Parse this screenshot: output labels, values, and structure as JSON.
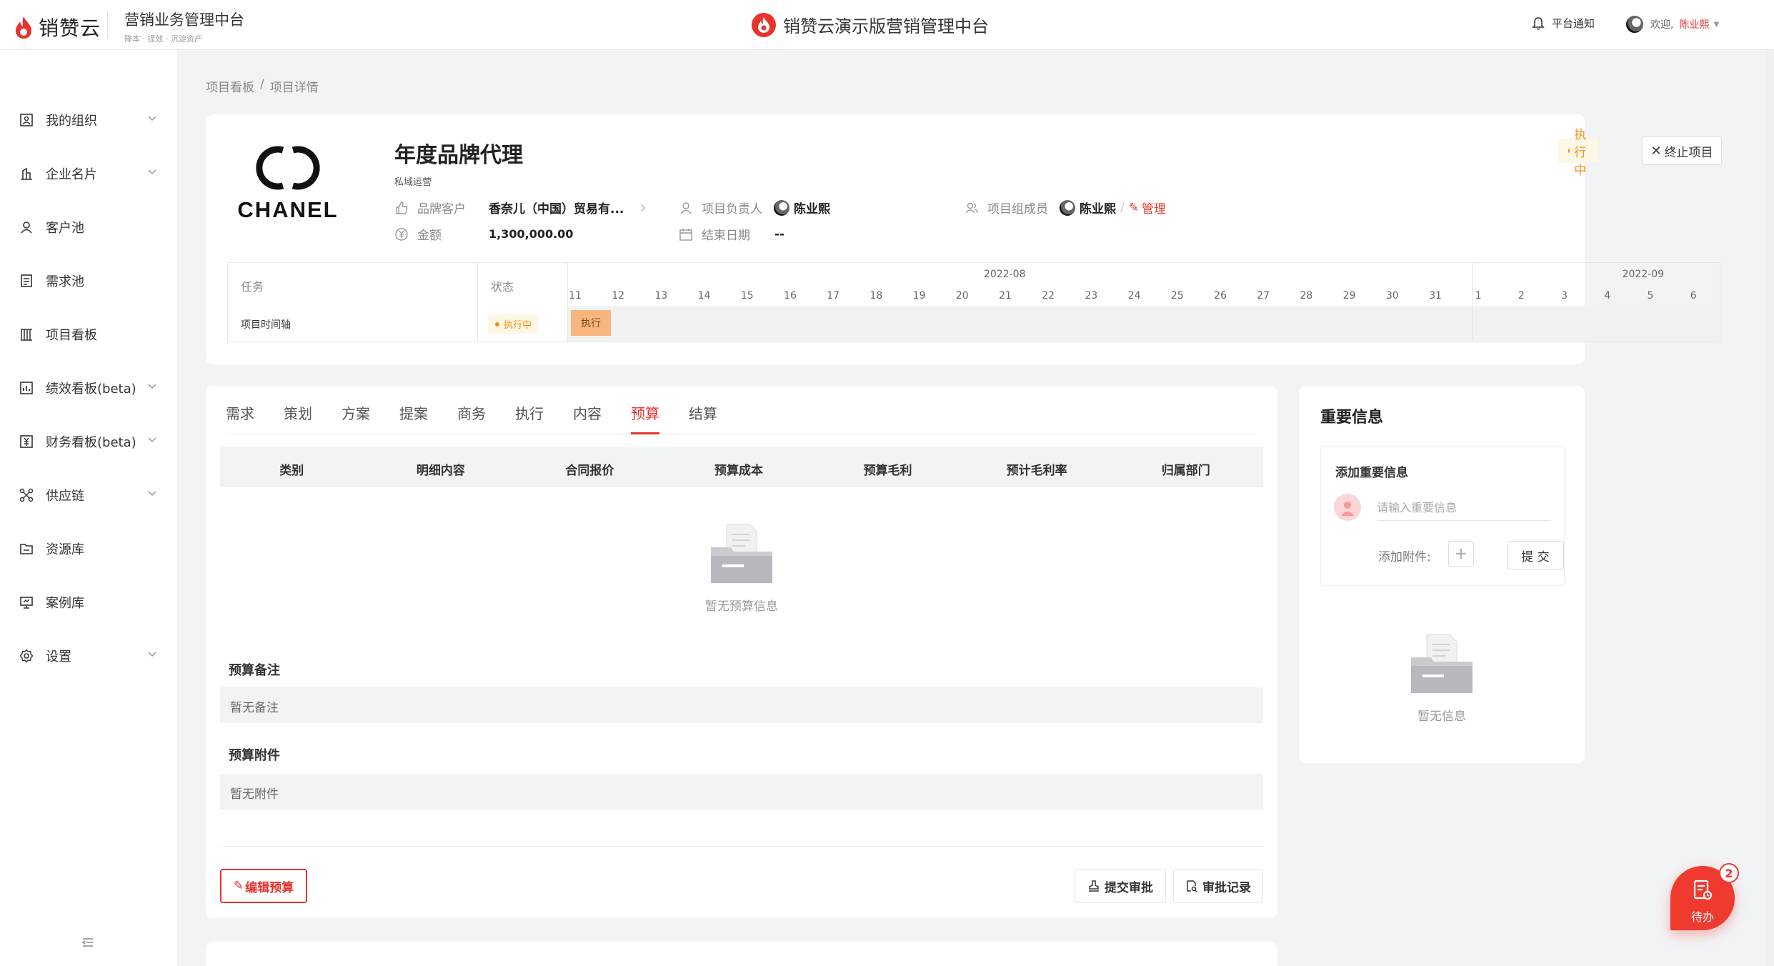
{
  "header": {
    "brand_name": "销赞云",
    "system_title": "营销业务管理中台",
    "system_tags": "降本 · 提效 · 沉淀资产",
    "center_title": "销赞云演示版营销管理中台",
    "notice_label": "平台通知",
    "welcome_prefix": "欢迎,",
    "username": "陈业熙"
  },
  "sidebar": {
    "items": [
      {
        "label": "我的组织",
        "icon": "org-icon",
        "has_arrow": true
      },
      {
        "label": "企业名片",
        "icon": "building-icon",
        "has_arrow": true
      },
      {
        "label": "客户池",
        "icon": "user-icon",
        "has_arrow": false
      },
      {
        "label": "需求池",
        "icon": "list-icon",
        "has_arrow": false
      },
      {
        "label": "项目看板",
        "icon": "board-icon",
        "has_arrow": false
      },
      {
        "label": "绩效看板(beta)",
        "icon": "chart-icon",
        "has_arrow": true
      },
      {
        "label": "财务看板(beta)",
        "icon": "finance-icon",
        "has_arrow": true
      },
      {
        "label": "供应链",
        "icon": "network-icon",
        "has_arrow": true
      },
      {
        "label": "资源库",
        "icon": "folder-icon",
        "has_arrow": false
      },
      {
        "label": "案例库",
        "icon": "presentation-icon",
        "has_arrow": false
      },
      {
        "label": "设置",
        "icon": "gear-icon",
        "has_arrow": true
      }
    ]
  },
  "breadcrumb": {
    "items": [
      "项目看板",
      "项目详情"
    ],
    "separator": "/"
  },
  "project": {
    "logo_text": "CHANEL",
    "title": "年度品牌代理",
    "subtitle": "私域运营",
    "status": "执行中",
    "terminate_label": "终止项目",
    "brand_customer_label": "品牌客户",
    "brand_customer_value": "香奈儿（中国）贸易有...",
    "owner_label": "项目负责人",
    "owner_value": "陈业熙",
    "members_label": "项目组成员",
    "members_value": "陈业熙",
    "manage_label": "管理",
    "amount_label": "金额",
    "amount_value": "1,300,000.00",
    "end_date_label": "结束日期",
    "end_date_value": "--"
  },
  "timeline": {
    "task_header": "任务",
    "status_header": "状态",
    "months": [
      {
        "label": "2022-08"
      },
      {
        "label": "2022-09"
      }
    ],
    "days": [
      "11",
      "12",
      "13",
      "14",
      "15",
      "16",
      "17",
      "18",
      "19",
      "20",
      "21",
      "22",
      "23",
      "24",
      "25",
      "26",
      "27",
      "28",
      "29",
      "30",
      "31",
      "1",
      "2",
      "3",
      "4",
      "5",
      "6"
    ],
    "row_task": "项目时间轴",
    "row_status": "执行中",
    "bar_label": "执行"
  },
  "budget": {
    "tabs": [
      "需求",
      "策划",
      "方案",
      "提案",
      "商务",
      "执行",
      "内容",
      "预算",
      "结算"
    ],
    "active_tab": "预算",
    "columns": [
      "类别",
      "明细内容",
      "合同报价",
      "预算成本",
      "预算毛利",
      "预计毛利率",
      "归属部门"
    ],
    "empty_text": "暂无预算信息",
    "note_title": "预算备注",
    "note_value": "暂无备注",
    "attach_title": "预算附件",
    "attach_value": "暂无附件",
    "edit_label": "编辑预算",
    "submit_approval_label": "提交审批",
    "approval_record_label": "审批记录"
  },
  "important": {
    "title": "重要信息",
    "add_title": "添加重要信息",
    "input_placeholder": "请输入重要信息",
    "attach_label": "添加附件:",
    "submit_label": "提 交",
    "empty_text": "暂无信息"
  },
  "todo": {
    "label": "待办",
    "count": "2"
  },
  "colors": {
    "accent": "#e8322c",
    "status_bg": "#fff7e6",
    "status_fg": "#fa8c16",
    "bar": "#f9b57e"
  }
}
